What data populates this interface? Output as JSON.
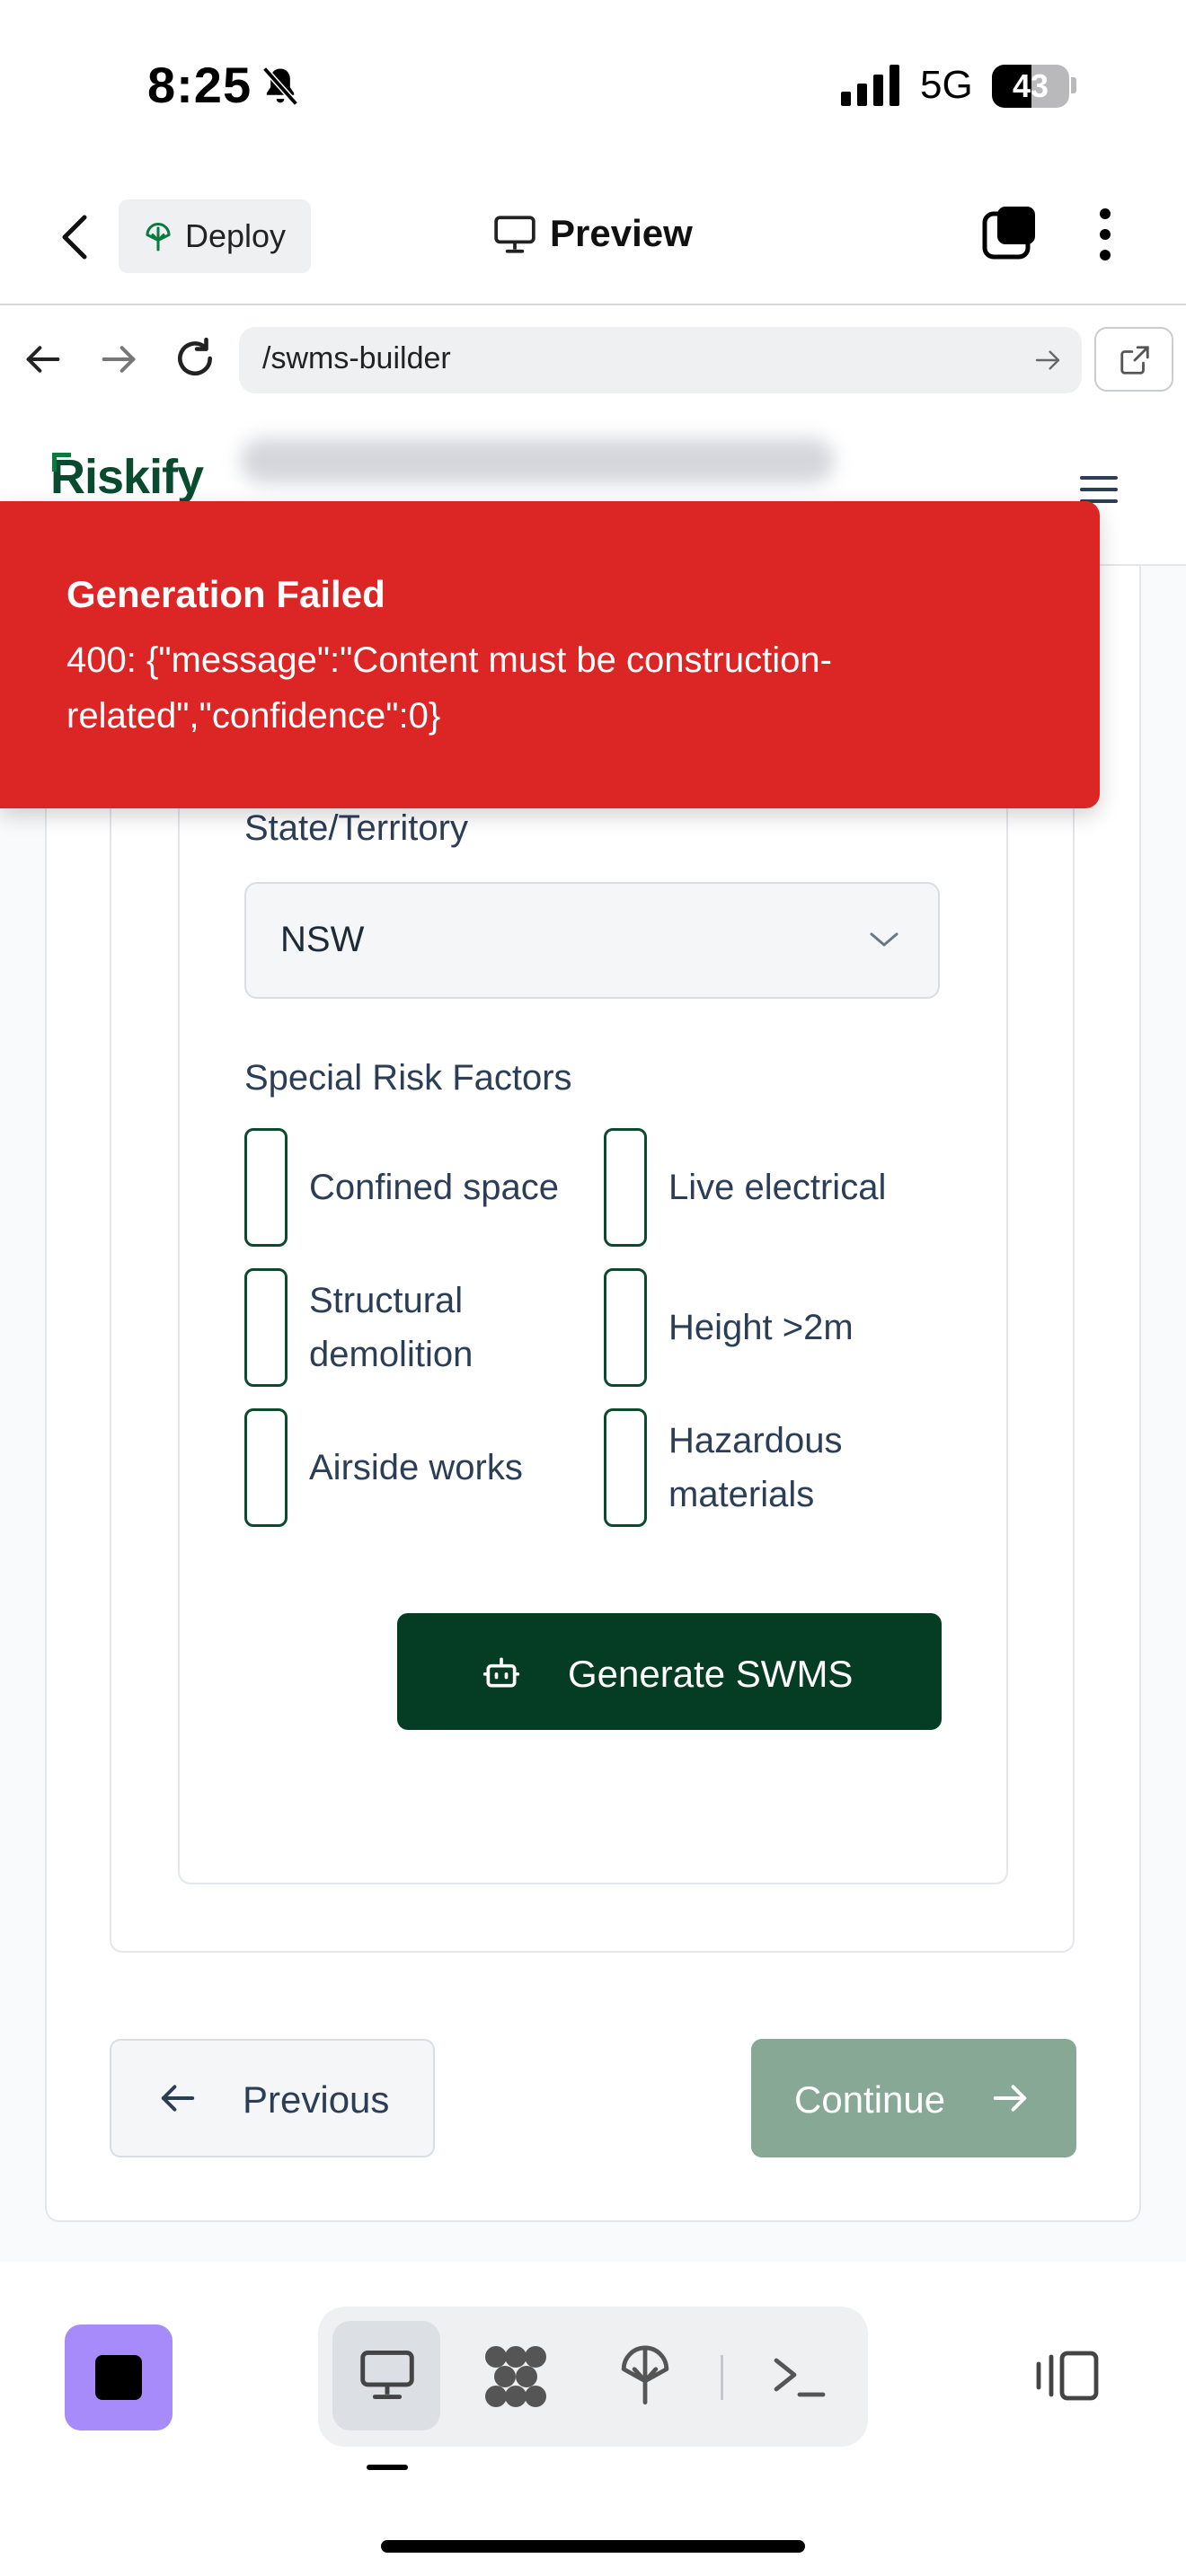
{
  "status_bar": {
    "time": "8:25",
    "network": "5G",
    "battery": "43"
  },
  "preview_header": {
    "deploy_label": "Deploy",
    "title": "Preview"
  },
  "browser": {
    "url": "/swms-builder"
  },
  "app": {
    "logo_text": "Riskify"
  },
  "toast": {
    "title": "Generation Failed",
    "message": "400: {\"message\":\"Content must be construction-related\",\"confidence\":0}"
  },
  "form": {
    "state_label": "State/Territory",
    "state_value": "NSW",
    "risk_label": "Special Risk Factors",
    "risk_factors": [
      {
        "label": "Confined space",
        "checked": false
      },
      {
        "label": "Live electrical",
        "checked": false
      },
      {
        "label": "Structural demolition",
        "checked": false
      },
      {
        "label": "Height >2m",
        "checked": false
      },
      {
        "label": "Airside works",
        "checked": false
      },
      {
        "label": "Hazardous materials",
        "checked": false
      }
    ],
    "generate_label": "Generate SWMS"
  },
  "nav": {
    "previous_label": "Previous",
    "continue_label": "Continue"
  },
  "colors": {
    "brand_green": "#053d24",
    "toast_red": "#dc2626",
    "continue_disabled": "#88a896",
    "stop_purple": "#a78bfa"
  }
}
